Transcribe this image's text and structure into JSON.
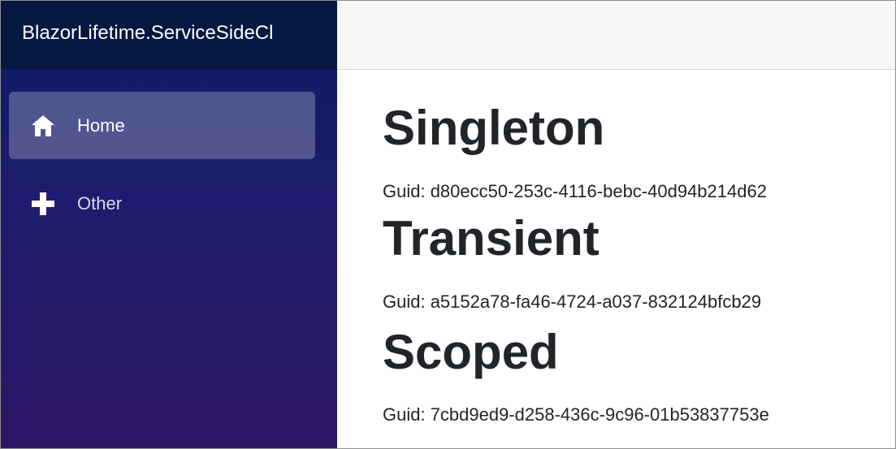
{
  "app": {
    "brand": "BlazorLifetime.ServiceSideCl"
  },
  "nav": {
    "items": [
      {
        "label": "Home",
        "icon": "home-icon",
        "active": true
      },
      {
        "label": "Other",
        "icon": "plus-icon",
        "active": false
      }
    ]
  },
  "services": [
    {
      "title": "Singleton",
      "guid": "Guid: d80ecc50-253c-4116-bebc-40d94b214d62"
    },
    {
      "title": "Transient",
      "guid": "Guid: a5152a78-fa46-4724-a037-832124bfcb29"
    },
    {
      "title": "Scoped",
      "guid": "Guid: 7cbd9ed9-d258-436c-9c96-01b53837753e"
    }
  ],
  "colors": {
    "sidebar_top": "#0b1d63",
    "sidebar_bottom": "#2e1665",
    "brand_bar": "#061840",
    "topbar": "#f7f7f7",
    "text": "#212529"
  }
}
